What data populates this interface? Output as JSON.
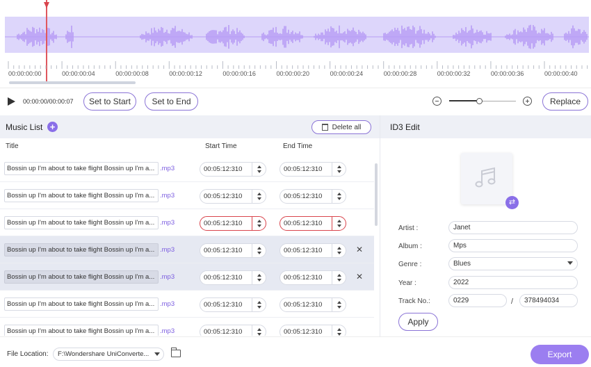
{
  "timeline": {
    "labels": [
      "00:00:00:00",
      "00:00:00:04",
      "00:00:00:08",
      "00:00:00:12",
      "00:00:00:16",
      "00:00:00:20",
      "00:00:00:24",
      "00:00:00:28",
      "00:00:00:32",
      "00:00:00:36",
      "00:00:00:40"
    ]
  },
  "player": {
    "time": "00:00:00/00:00:07",
    "set_start": "Set to Start",
    "set_end": "Set to End",
    "replace": "Replace",
    "zoom_level": 0.45
  },
  "music_list": {
    "title": "Music List",
    "add": "+",
    "delete_all": "Delete all",
    "columns": {
      "title": "Title",
      "start": "Start Time",
      "end": "End Time"
    },
    "rows": [
      {
        "title": "Bossin up I'm about to take flight Bossin up I'm a...",
        "ext": ".mp3",
        "start": "00:05:12:310",
        "end": "00:05:12:310",
        "close": ""
      },
      {
        "title": "Bossin up I'm about to take flight Bossin up I'm a...",
        "ext": ".mp3",
        "start": "00:05:12:310",
        "end": "00:05:12:310",
        "close": ""
      },
      {
        "title": "Bossin up I'm about to take flight Bossin up I'm a...",
        "ext": ".mp3",
        "start": "00:05:12:310",
        "end": "00:05:12:310",
        "close": ""
      },
      {
        "title": "Bossin up I'm about to take flight Bossin up I'm a...",
        "ext": ".mp3",
        "start": "00:05:12:310",
        "end": "00:05:12:310",
        "close": "✕"
      },
      {
        "title": "Bossin up I'm about to take flight Bossin up I'm a...",
        "ext": ".mp3",
        "start": "00:05:12:310",
        "end": "00:05:12:310",
        "close": "✕"
      },
      {
        "title": "Bossin up I'm about to take flight Bossin up I'm a...",
        "ext": ".mp3",
        "start": "00:05:12:310",
        "end": "00:05:12:310",
        "close": ""
      },
      {
        "title": "Bossin up I'm about to take flight Bossin up I'm a...",
        "ext": ".mp3",
        "start": "00:05:12:310",
        "end": "00:05:12:310",
        "close": ""
      }
    ]
  },
  "id3": {
    "title": "ID3 Edit",
    "swap": "⇄",
    "artist_label": "Artist :",
    "artist": "Janet",
    "album_label": "Album :",
    "album": "Mps",
    "genre_label": "Genre :",
    "genre": "Blues",
    "year_label": "Year :",
    "year": "2022",
    "track_label": "Track No.:",
    "track_no": "0229",
    "slash": "/",
    "track_total": "378494034",
    "apply": "Apply"
  },
  "footer": {
    "location_label": "File Location:",
    "location": "F:\\Wondershare UniConverte...",
    "export": "Export"
  },
  "colors": {
    "accent": "#8a6fe8",
    "wave": "#b89cf5",
    "wave_bg": "#ddd6fb",
    "error": "#d9444c"
  }
}
